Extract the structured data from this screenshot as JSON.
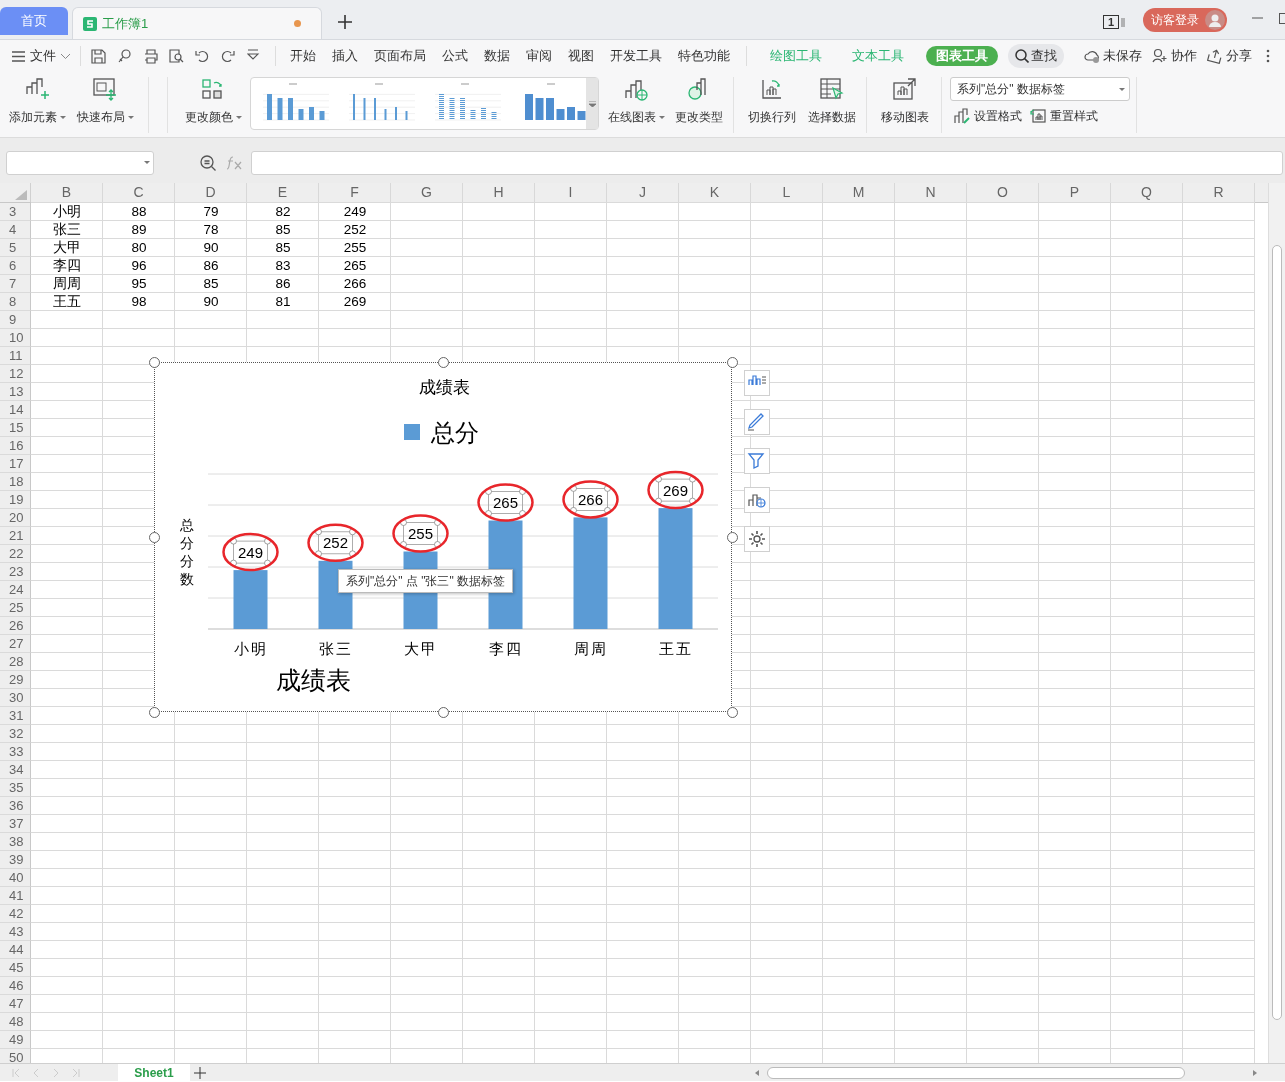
{
  "tabs": [
    {
      "label": "首页",
      "selected": false
    },
    {
      "label": "工作簿1",
      "selected": true,
      "modified": true
    }
  ],
  "window_badge": "1",
  "login": "访客登录",
  "file_menu": "文件",
  "menu_tabs": [
    {
      "label": "开始",
      "kind": "plain",
      "selected": false
    },
    {
      "label": "插入",
      "kind": "plain",
      "selected": false
    },
    {
      "label": "页面布局",
      "kind": "plain",
      "selected": false
    },
    {
      "label": "公式",
      "kind": "plain",
      "selected": false
    },
    {
      "label": "数据",
      "kind": "plain",
      "selected": false
    },
    {
      "label": "审阅",
      "kind": "plain",
      "selected": false
    },
    {
      "label": "视图",
      "kind": "plain",
      "selected": false
    },
    {
      "label": "开发工具",
      "kind": "plain",
      "selected": false
    },
    {
      "label": "特色功能",
      "kind": "plain",
      "selected": false
    },
    {
      "label": "绘图工具",
      "kind": "context",
      "selected": false
    },
    {
      "label": "文本工具",
      "kind": "context",
      "selected": false
    },
    {
      "label": "图表工具",
      "kind": "context",
      "selected": true
    }
  ],
  "search": "查找",
  "right_actions": [
    "未保存",
    "协作",
    "分享"
  ],
  "ribbon_left": [
    {
      "label": "添加元素",
      "dropdown": true
    },
    {
      "label": "快速布局",
      "dropdown": true
    },
    {
      "label": "更改颜色",
      "dropdown": true
    }
  ],
  "ribbon_right": [
    {
      "label": "在线图表",
      "dropdown": true
    },
    {
      "label": "更改类型",
      "dropdown": false
    },
    {
      "label": "切换行列",
      "dropdown": false
    },
    {
      "label": "选择数据",
      "dropdown": false
    },
    {
      "label": "移动图表",
      "dropdown": false
    }
  ],
  "element_selector": "系列\"总分\" 数据标签",
  "format_buttons": [
    "设置格式",
    "重置样式"
  ],
  "columns": [
    "B",
    "C",
    "D",
    "E",
    "F",
    "G",
    "H",
    "I",
    "J",
    "K",
    "L",
    "M",
    "N",
    "O",
    "P",
    "Q",
    "R"
  ],
  "rows": [
    {
      "number": "3",
      "cells": [
        "小明",
        "88",
        "79",
        "82",
        "249"
      ]
    },
    {
      "number": "4",
      "cells": [
        "张三",
        "89",
        "78",
        "85",
        "252"
      ]
    },
    {
      "number": "5",
      "cells": [
        "大甲",
        "80",
        "90",
        "85",
        "255"
      ]
    },
    {
      "number": "6",
      "cells": [
        "李四",
        "96",
        "86",
        "83",
        "265"
      ]
    },
    {
      "number": "7",
      "cells": [
        "周周",
        "95",
        "85",
        "86",
        "266"
      ]
    },
    {
      "number": "8",
      "cells": [
        "王五",
        "98",
        "90",
        "81",
        "269"
      ]
    },
    {
      "number": "9"
    },
    {
      "number": "10"
    },
    {
      "number": "11"
    },
    {
      "number": "12"
    },
    {
      "number": "13"
    },
    {
      "number": "14"
    },
    {
      "number": "15"
    },
    {
      "number": "16"
    },
    {
      "number": "17"
    },
    {
      "number": "18"
    },
    {
      "number": "19"
    },
    {
      "number": "20"
    },
    {
      "number": "21"
    },
    {
      "number": "22"
    },
    {
      "number": "23"
    },
    {
      "number": "24"
    },
    {
      "number": "25"
    },
    {
      "number": "26"
    },
    {
      "number": "27"
    },
    {
      "number": "28"
    },
    {
      "number": "29"
    },
    {
      "number": "30"
    },
    {
      "number": "31"
    },
    {
      "number": "32"
    },
    {
      "number": "33"
    },
    {
      "number": "34"
    },
    {
      "number": "35"
    },
    {
      "number": "36"
    },
    {
      "number": "37"
    },
    {
      "number": "38"
    },
    {
      "number": "39"
    },
    {
      "number": "40"
    },
    {
      "number": "41"
    },
    {
      "number": "42"
    },
    {
      "number": "43"
    },
    {
      "number": "44"
    },
    {
      "number": "45"
    },
    {
      "number": "46"
    },
    {
      "number": "47"
    },
    {
      "number": "48"
    },
    {
      "number": "49"
    },
    {
      "number": "50"
    }
  ],
  "chart": {
    "selected": true,
    "labels_selected": true,
    "labels_circled": true,
    "caption": "成绩表",
    "tooltip": "系列\"总分\" 点 \"张三\" 数据标签",
    "chart_data": {
      "type": "bar",
      "title": "成绩表",
      "ylabel": "总分分数",
      "categories": [
        "小明",
        "张三",
        "大甲",
        "李四",
        "周周",
        "王五"
      ],
      "series": [
        {
          "name": "总分",
          "color": "#5b9bd5",
          "values": [
            249,
            252,
            255,
            265,
            266,
            269
          ]
        }
      ],
      "ylim": [
        230,
        280
      ],
      "data_labels": true
    }
  },
  "sheet_tabs": [
    {
      "label": "Sheet1",
      "selected": true
    }
  ]
}
